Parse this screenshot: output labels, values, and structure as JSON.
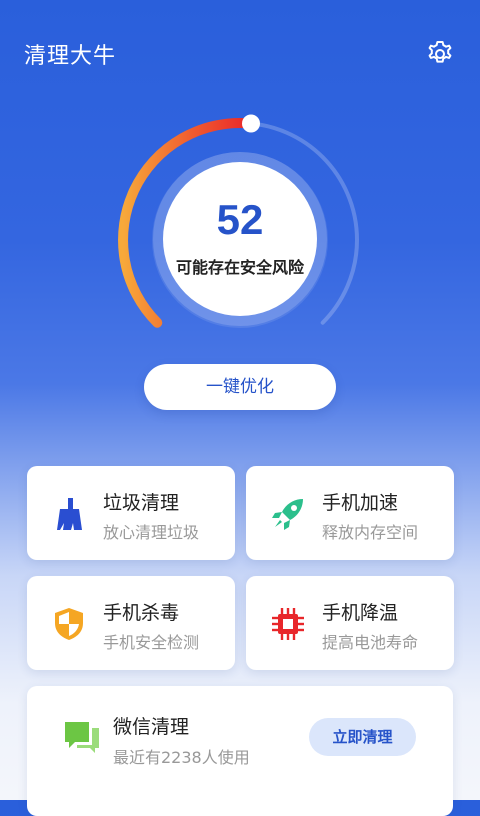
{
  "header": {
    "app_title": "清理大牛",
    "settings_icon": "gear-icon"
  },
  "gauge": {
    "score": "52",
    "status_text": "可能存在安全风险",
    "score_fraction": 0.52,
    "arc_colors": [
      "#f7a93a",
      "#f05a2f",
      "#e8262a"
    ]
  },
  "optimize_button": "一键优化",
  "features": [
    {
      "title": "垃圾清理",
      "subtitle": "放心清理垃圾",
      "icon": "broom-icon",
      "color": "#2a4ed1"
    },
    {
      "title": "手机加速",
      "subtitle": "释放内存空间",
      "icon": "rocket-icon",
      "color": "#2bbf8c"
    },
    {
      "title": "手机杀毒",
      "subtitle": "手机安全检测",
      "icon": "shield-icon",
      "color": "#f5a623"
    },
    {
      "title": "手机降温",
      "subtitle": "提高电池寿命",
      "icon": "chip-icon",
      "color": "#e8262a"
    }
  ],
  "wechat": {
    "title": "微信清理",
    "subtitle": "最近有2238人使用",
    "button": "立即清理",
    "icon": "chat-bubble-icon",
    "color": "#6cc644"
  }
}
